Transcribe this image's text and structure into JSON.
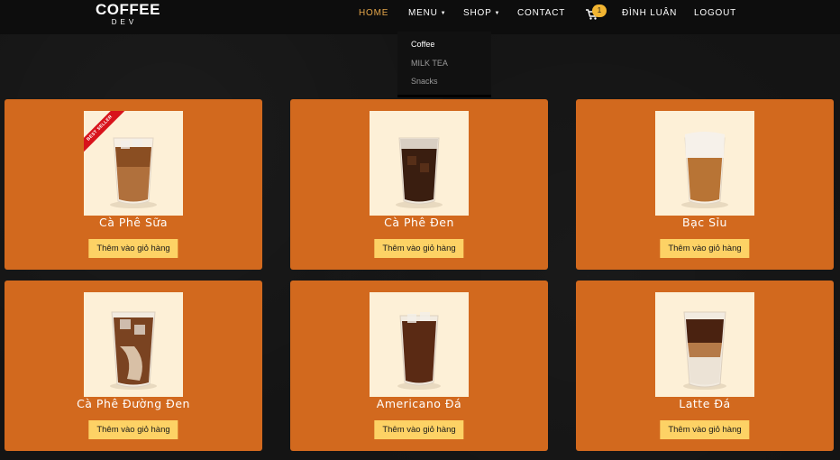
{
  "brand": {
    "line1": "COFFEE",
    "line2": "DEV"
  },
  "nav": {
    "home": "HOME",
    "menu": "MENU",
    "shop": "SHOP",
    "contact": "CONTACT",
    "cart_count": "1",
    "user": "ĐÌNH LUÂN",
    "logout": "LOGOUT"
  },
  "dropdown": [
    "Coffee",
    "MILK TEA",
    "Snacks"
  ],
  "products": [
    {
      "name": "Cà Phê Sữa",
      "badge": "BEST SELLER",
      "button": "Thêm vào giỏ hàng"
    },
    {
      "name": "Cà Phê Đen",
      "button": "Thêm vào giỏ hàng"
    },
    {
      "name": "Bạc Sỉu",
      "button": "Thêm vào giỏ hàng"
    },
    {
      "name": "Cà Phê Đường Đen",
      "button": "Thêm vào giỏ hàng"
    },
    {
      "name": "Americano Đá",
      "button": "Thêm vào giỏ hàng"
    },
    {
      "name": "Latte Đá",
      "button": "Thêm vào giỏ hàng"
    }
  ],
  "colors": {
    "accent": "#e5a64a",
    "card": "#d2691e",
    "button": "#fdd265",
    "badge": "#f2b532",
    "ribbon": "#d8131b"
  }
}
